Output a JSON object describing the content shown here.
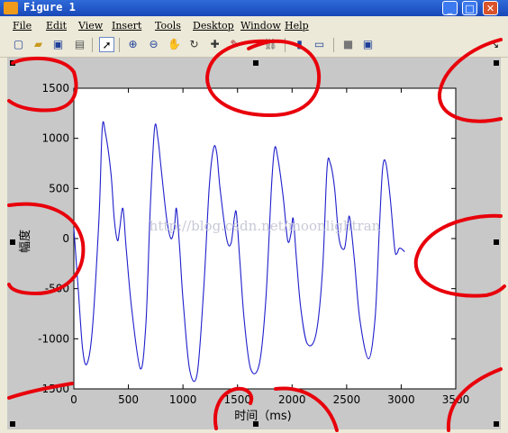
{
  "window": {
    "title": "Figure 1",
    "buttons": {
      "minimize": "_",
      "maximize": "□",
      "close": "✕"
    }
  },
  "menu": [
    "File",
    "Edit",
    "View",
    "Insert",
    "Tools",
    "Desktop",
    "Window",
    "Help"
  ],
  "toolbar": {
    "tools": [
      "new-figure",
      "open-file",
      "save",
      "print",
      "edit-plot",
      "zoom-in",
      "zoom-out",
      "pan",
      "rotate-3d",
      "data-cursor",
      "brush",
      "link-plot",
      "colorbar",
      "legend",
      "hide-plot-tools",
      "show-plot-tools"
    ],
    "dock_arrow": "↘"
  },
  "chart_data": {
    "type": "line",
    "xlabel": "时间（ms)",
    "ylabel": "幅度",
    "xlim": [
      0,
      3500
    ],
    "ylim": [
      -1500,
      1500
    ],
    "xticks": [
      0,
      500,
      1000,
      1500,
      2000,
      2500,
      3000,
      3500
    ],
    "xtick_labels": [
      "0",
      "500",
      "1000",
      "1500",
      "2000",
      "2500",
      "3000",
      "3500"
    ],
    "yticks": [
      -1500,
      -1000,
      -500,
      0,
      500,
      1000,
      1500
    ],
    "ytick_labels": [
      "-1500",
      "-1000",
      "-500",
      "0",
      "500",
      "1000",
      "1500"
    ],
    "series": [
      {
        "color": "#1f1fcc",
        "x": [
          0,
          40,
          80,
          120,
          170,
          230,
          260,
          290,
          340,
          370,
          400,
          420,
          450,
          480,
          530,
          610,
          660,
          700,
          740,
          770,
          800,
          850,
          890,
          920,
          940,
          970,
          1000,
          1060,
          1130,
          1190,
          1240,
          1280,
          1310,
          1340,
          1400,
          1440,
          1470,
          1490,
          1520,
          1560,
          1620,
          1700,
          1760,
          1810,
          1840,
          1870,
          1920,
          1960,
          1990,
          2010,
          2040,
          2080,
          2140,
          2220,
          2280,
          2320,
          2350,
          2390,
          2430,
          2480,
          2510,
          2530,
          2570,
          2620,
          2700,
          2760,
          2800,
          2830,
          2860,
          2900,
          2940,
          2960,
          2980,
          3000,
          3030
        ],
        "y": [
          100,
          -500,
          -1100,
          -1250,
          -900,
          200,
          1100,
          1050,
          650,
          200,
          -20,
          100,
          300,
          -100,
          -700,
          -1300,
          -850,
          300,
          1100,
          1000,
          700,
          200,
          0,
          100,
          300,
          -100,
          -600,
          -1300,
          -1350,
          -500,
          500,
          900,
          850,
          500,
          0,
          -50,
          200,
          250,
          -200,
          -800,
          -1300,
          -1250,
          -600,
          500,
          900,
          800,
          400,
          -20,
          50,
          200,
          -200,
          -700,
          -1050,
          -950,
          -300,
          700,
          750,
          500,
          0,
          -100,
          150,
          200,
          -200,
          -800,
          -1200,
          -800,
          100,
          700,
          750,
          400,
          -100,
          -150,
          -100,
          -100,
          -130
        ]
      }
    ],
    "grid": false,
    "watermark": "http://blog.csdn.net/moonlightran"
  }
}
